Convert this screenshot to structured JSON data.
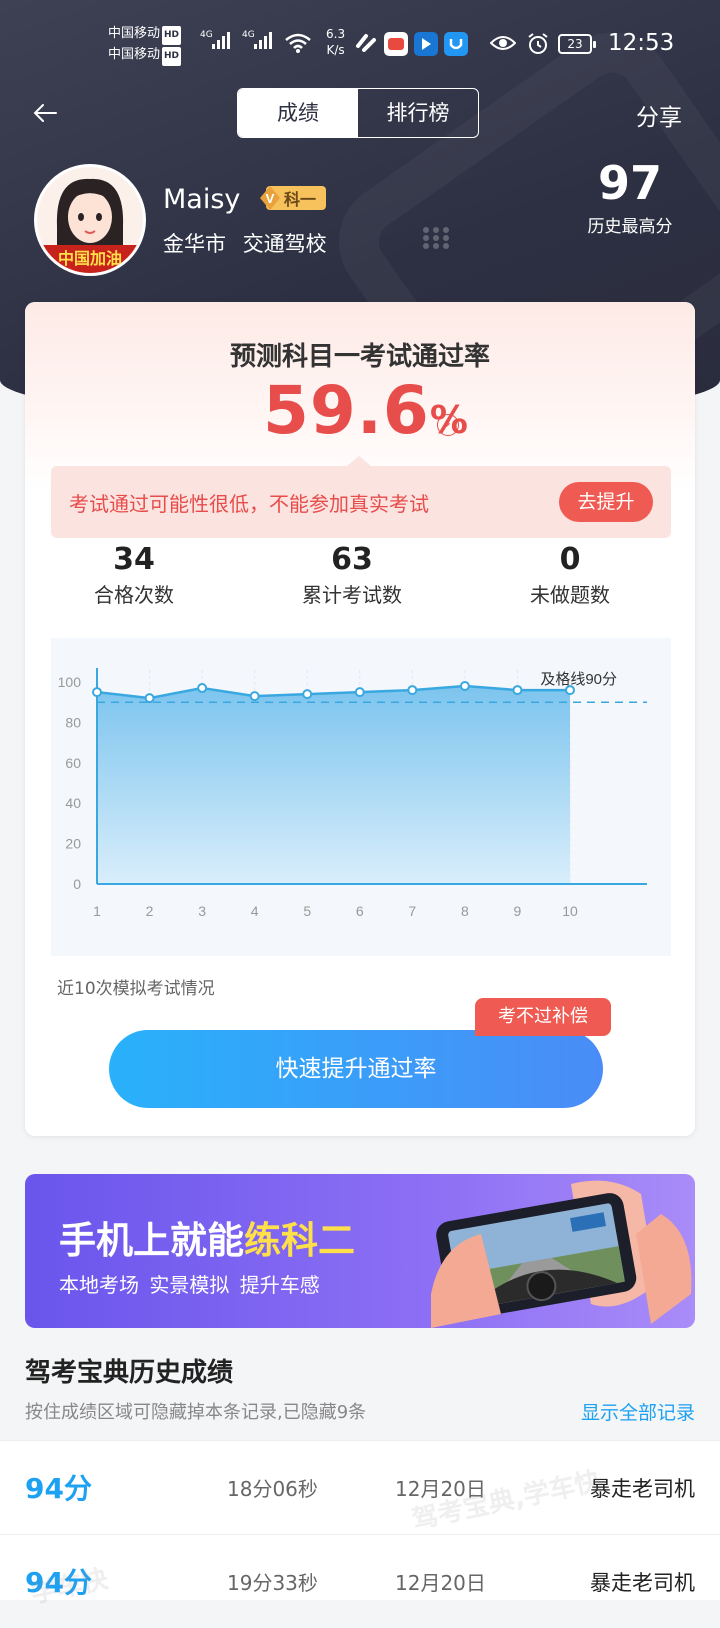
{
  "status_bar": {
    "carrier1": "中国移动",
    "carrier2": "中国移动",
    "hd": "HD",
    "net1": "4G",
    "net2": "4G",
    "speed_value": "6.3",
    "speed_unit": "K/s",
    "battery": "23",
    "time": "12:53"
  },
  "nav": {
    "tabs": [
      {
        "label": "成绩",
        "active": true
      },
      {
        "label": "排行榜",
        "active": false
      }
    ],
    "share_label": "分享"
  },
  "profile": {
    "name": "Maisy",
    "badge": "科一",
    "city": "金华市",
    "school": "交通驾校",
    "avatar_caption": "中国加油",
    "best_score": "97",
    "best_label": "历史最高分"
  },
  "prediction": {
    "title": "预测科目一考试通过率",
    "rate": "59.6",
    "percent_sign": "%",
    "warning": "考试通过可能性很低，不能参加真实考试",
    "improve_label": "去提升"
  },
  "stats": [
    {
      "value": "34",
      "label": "合格次数"
    },
    {
      "value": "63",
      "label": "累计考试数"
    },
    {
      "value": "0",
      "label": "未做题数"
    }
  ],
  "chart_data": {
    "type": "area",
    "x": [
      1,
      2,
      3,
      4,
      5,
      6,
      7,
      8,
      9,
      10
    ],
    "values": [
      95,
      92,
      97,
      93,
      94,
      95,
      96,
      98,
      96,
      96
    ],
    "ylim": [
      0,
      100
    ],
    "yticks": [
      0,
      20,
      40,
      60,
      80,
      100
    ],
    "threshold": 90,
    "threshold_label": "及格线90分",
    "grid": true
  },
  "chart_caption": "近10次模拟考试情况",
  "cta": {
    "label": "快速提升通过率",
    "tag": "考不过补偿"
  },
  "banner": {
    "title_prefix": "手机上就能",
    "title_highlight": "练科二",
    "subtitle": "本地考场 实景模拟 提升车感"
  },
  "history": {
    "title": "驾考宝典历史成绩",
    "hint": "按住成绩区域可隐藏掉本条记录,已隐藏9条",
    "show_all": "显示全部记录",
    "rows": [
      {
        "score": "94分",
        "duration": "18分06秒",
        "date": "12月20日",
        "title": "暴走老司机"
      },
      {
        "score": "94分",
        "duration": "19分33秒",
        "date": "12月20日",
        "title": "暴走老司机"
      }
    ]
  },
  "watermark": [
    "驾考宝典,学车快",
    "学车快"
  ],
  "colors": {
    "accent_red": "#e74d4b",
    "accent_blue": "#1da1f2",
    "header_dark": "#2d3042",
    "banner_purple": "#6a55ec",
    "highlight_yellow": "#ffe04a"
  }
}
